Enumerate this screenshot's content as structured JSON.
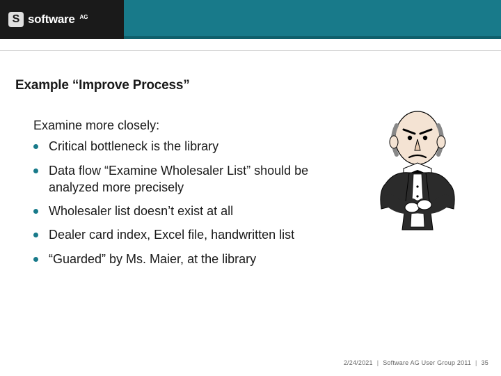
{
  "brand": {
    "mark": "S",
    "name": "software",
    "suffix": "AG"
  },
  "title": "Example “Improve Process”",
  "lead": "Examine more closely:",
  "bullets": [
    "Critical bottleneck is the library",
    "Data flow “Examine Wholesaler List” should be analyzed more precisely",
    "Wholesaler list doesn’t exist at all",
    "Dealer card index, Excel file, handwritten list",
    "“Guarded” by Ms. Maier, at the library"
  ],
  "footer": {
    "date": "2/24/2021",
    "event": "Software AG User Group 2011",
    "page": "35"
  },
  "illustration": {
    "name": "stern-butler-illustration"
  }
}
